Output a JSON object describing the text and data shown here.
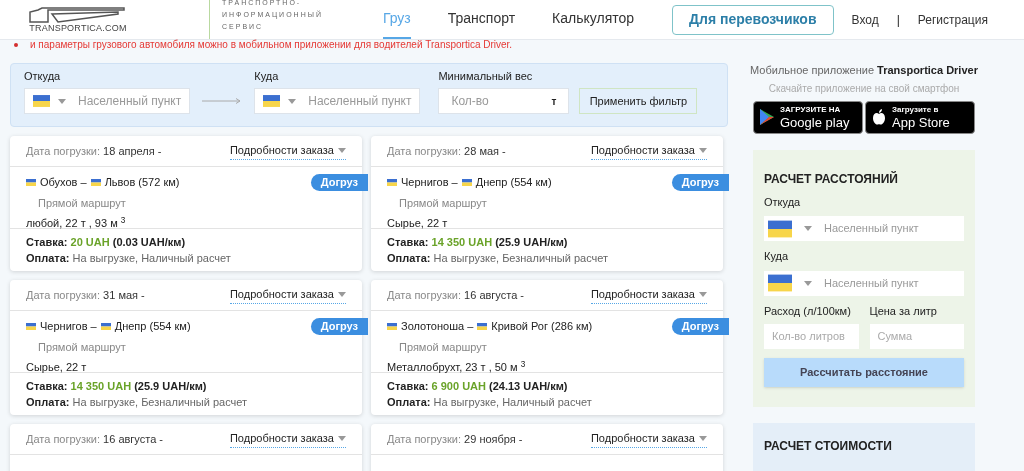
{
  "header": {
    "logo_text": "TRANSPORTICA.COM",
    "tagline": [
      "ТРАНСПОРТНО-",
      "ИНФОРМАЦИОННЫЙ",
      "СЕРВИС"
    ],
    "nav": [
      {
        "label": "Груз",
        "selected": true
      },
      {
        "label": "Транспорт",
        "selected": false
      },
      {
        "label": "Калькулятор",
        "selected": false
      }
    ],
    "carriers_button": "Для перевозчиков",
    "login": "Вход",
    "separator": "|",
    "register": "Регистрация"
  },
  "notice": "и параметры грузового автомобиля можно в мобильном приложении для водителей Transportica Driver.",
  "filter": {
    "from_label": "Откуда",
    "from_placeholder": "Населенный пункт",
    "to_label": "Куда",
    "to_placeholder": "Населенный пункт",
    "weight_label": "Минимальный вес",
    "weight_placeholder": "Кол-во",
    "weight_unit": "т",
    "apply": "Применить фильтр"
  },
  "cards": [
    {
      "date_label": "Дата погрузки:",
      "date": "18 апреля -",
      "details": "Подробности заказа",
      "from": "Обухов",
      "dash": "–",
      "to": "Львов",
      "distance": "(572 км)",
      "badge": "Догруз",
      "route_type": "Прямой маршрут",
      "cargo": "любой, 22 т , 93 м $^{3}$",
      "rate_label": "Ставка:",
      "rate": "20 UAH",
      "per_km": "(0.03 UAH/км)",
      "payment_label": "Оплата:",
      "payment": "На выгрузке, Наличный расчет"
    },
    {
      "date_label": "Дата погрузки:",
      "date": "28 мая -",
      "details": "Подробности заказа",
      "from": "Чернигов",
      "dash": "–",
      "to": "Днепр",
      "distance": "(554 км)",
      "badge": "Догруз",
      "route_type": "Прямой маршрут",
      "cargo": "Сырье, 22 т",
      "rate_label": "Ставка:",
      "rate": "14 350 UAH",
      "per_km": "(25.9 UAH/км)",
      "payment_label": "Оплата:",
      "payment": "На выгрузке, Безналичный расчет"
    },
    {
      "date_label": "Дата погрузки:",
      "date": "31 мая -",
      "details": "Подробности заказа",
      "from": "Чернигов",
      "dash": "–",
      "to": "Днепр",
      "distance": "(554 км)",
      "badge": "Догруз",
      "route_type": "Прямой маршрут",
      "cargo": "Сырье, 22 т",
      "rate_label": "Ставка:",
      "rate": "14 350 UAH",
      "per_km": "(25.9 UAH/км)",
      "payment_label": "Оплата:",
      "payment": "На выгрузке, Безналичный расчет"
    },
    {
      "date_label": "Дата погрузки:",
      "date": "16 августа -",
      "details": "Подробности заказа",
      "from": "Золотоноша",
      "dash": "–",
      "to": "Кривой Рог",
      "distance": "(286 км)",
      "badge": "Догруз",
      "route_type": "Прямой маршрут",
      "cargo": "Металлобрухт, 23 т , 50 м $^{3}$",
      "rate_label": "Ставка:",
      "rate": "6 900 UAH",
      "per_km": "(24.13 UAH/км)",
      "payment_label": "Оплата:",
      "payment": "На выгрузке, Наличный расчет"
    },
    {
      "date_label": "Дата погрузки:",
      "date": "16 августа -",
      "details": "Подробности заказа"
    },
    {
      "date_label": "Дата погрузки:",
      "date": "29 ноября -",
      "details": "Подробности заказа"
    }
  ],
  "sidebar": {
    "app_title": "Мобильное приложение **Transportica Driver**",
    "app_subtitle": "Скачайте приложение на свой смартфон",
    "stores": [
      {
        "kind": "google",
        "small": "ЗАГРУЗИТЕ НА",
        "big": "Google play"
      },
      {
        "kind": "apple",
        "small": "Загрузите в",
        "big": "App Store"
      }
    ],
    "distance": {
      "title": "РАСЧЕТ РАССТОЯНИЙ",
      "from_label": "Откуда",
      "from_placeholder": "Населенный пункт",
      "to_label": "Куда",
      "to_placeholder": "Населенный пункт",
      "consumption_label": "Расход (л/100км)",
      "consumption_placeholder": "Кол-во литров",
      "price_label": "Цена за литр",
      "price_placeholder": "Сумма",
      "button": "Рассчитать расстояние"
    },
    "cost": {
      "title": "РАСЧЕТ СТОИМОСТИ"
    }
  }
}
